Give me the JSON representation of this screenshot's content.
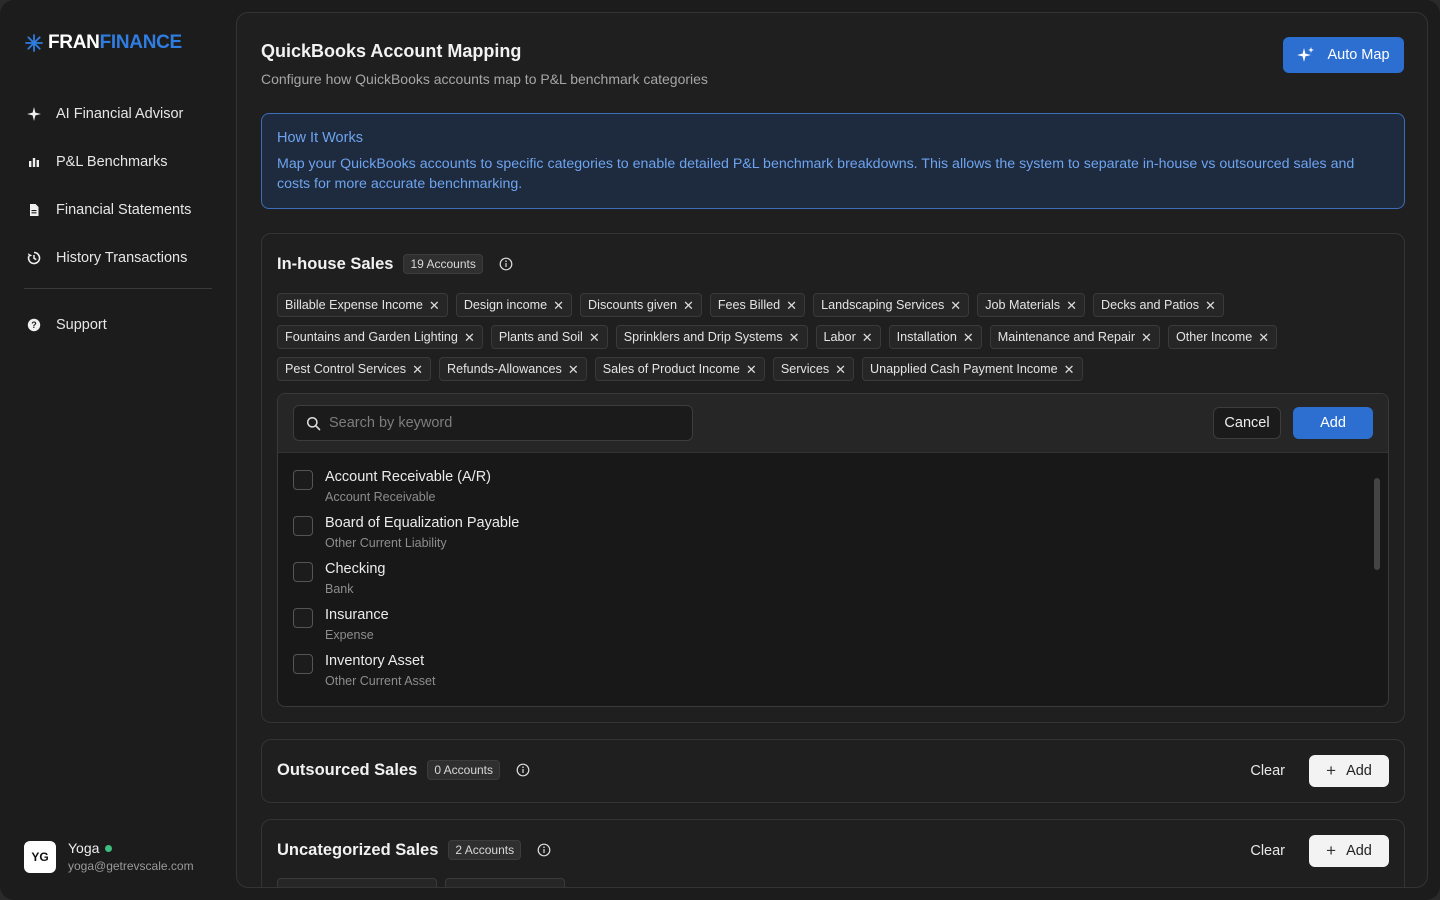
{
  "brand": {
    "part1": "FRAN",
    "part2": "FINANCE",
    "accent": "#2f7de1"
  },
  "sidebar": {
    "items": [
      {
        "label": "AI Financial Advisor",
        "icon": "sparkle-icon"
      },
      {
        "label": "P&L Benchmarks",
        "icon": "bar-chart-icon"
      },
      {
        "label": "Financial Statements",
        "icon": "document-icon"
      },
      {
        "label": "History Transactions",
        "icon": "history-icon"
      }
    ],
    "support": {
      "label": "Support",
      "icon": "help-icon"
    }
  },
  "user": {
    "initials": "YG",
    "name": "Yoga",
    "email": "yoga@getrevscale.com",
    "status_color": "#3fbf7f"
  },
  "header": {
    "title": "QuickBooks Account Mapping",
    "subtitle": "Configure how QuickBooks accounts map to P&L benchmark categories",
    "auto_map_label": "Auto Map"
  },
  "info": {
    "title": "How It Works",
    "text": "Map your QuickBooks accounts to specific categories to enable detailed P&L benchmark breakdowns. This allows the system to separate in-house vs outsourced sales and costs for more accurate benchmarking."
  },
  "inhouse": {
    "title": "In-house Sales",
    "count_label": "19 Accounts",
    "chips": [
      "Billable Expense Income",
      "Design income",
      "Discounts given",
      "Fees Billed",
      "Landscaping Services",
      "Job Materials",
      "Decks and Patios",
      "Fountains and Garden Lighting",
      "Plants and Soil",
      "Sprinklers and Drip Systems",
      "Labor",
      "Installation",
      "Maintenance and Repair",
      "Other Income",
      "Pest Control Services",
      "Refunds-Allowances",
      "Sales of Product Income",
      "Services",
      "Unapplied Cash Payment Income"
    ],
    "picker": {
      "search_placeholder": "Search by keyword",
      "cancel_label": "Cancel",
      "add_label": "Add",
      "options": [
        {
          "name": "Account Receivable (A/R)",
          "type": "Account Receivable"
        },
        {
          "name": "Board of Equalization Payable",
          "type": "Other Current Liability"
        },
        {
          "name": "Checking",
          "type": "Bank"
        },
        {
          "name": "Insurance",
          "type": "Expense"
        },
        {
          "name": "Inventory Asset",
          "type": "Other Current Asset"
        }
      ]
    }
  },
  "outsourced": {
    "title": "Outsourced Sales",
    "count_label": "0 Accounts",
    "clear_label": "Clear",
    "add_label": "Add"
  },
  "uncategorized": {
    "title": "Uncategorized Sales",
    "count_label": "2 Accounts",
    "clear_label": "Clear",
    "add_label": "Add"
  }
}
